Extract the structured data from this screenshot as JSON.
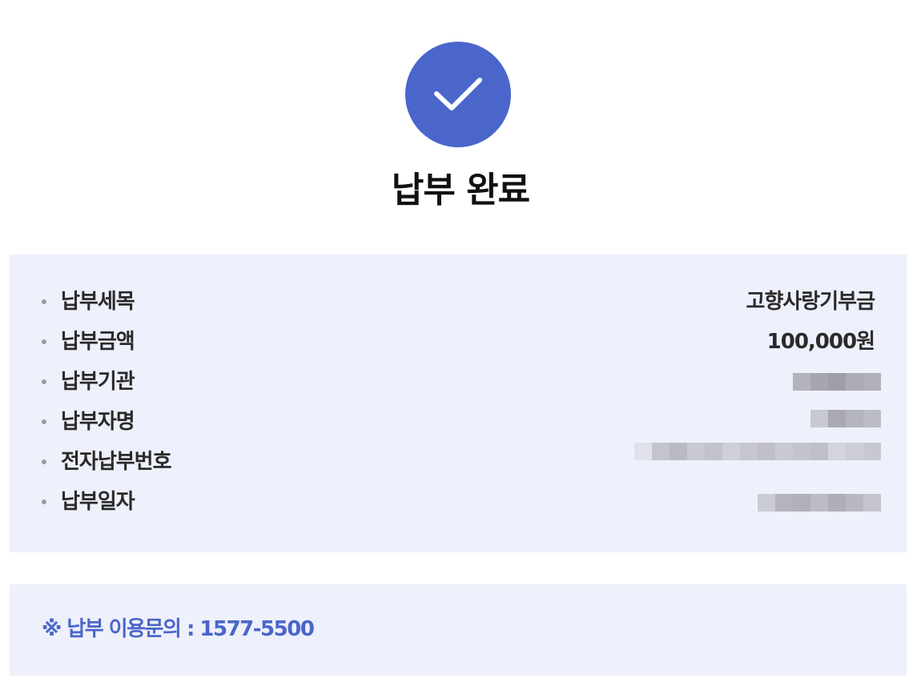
{
  "status": {
    "icon": "check-icon",
    "title": "납부 완료",
    "accent_color": "#4a66cb"
  },
  "details": {
    "rows": [
      {
        "label": "납부세목",
        "value": "고향사랑기부금"
      },
      {
        "label": "납부금액",
        "value": "100,000원"
      },
      {
        "label": "납부기관",
        "value": ""
      },
      {
        "label": "납부자명",
        "value": ""
      },
      {
        "label": "전자납부번호",
        "value": ""
      },
      {
        "label": "납부일자",
        "value": ""
      }
    ]
  },
  "contact": {
    "text": "※ 납부 이용문의 : 1577-5500"
  }
}
